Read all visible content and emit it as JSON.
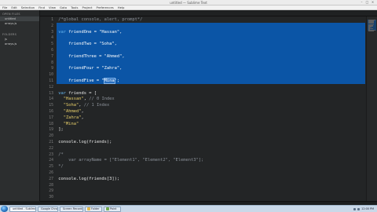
{
  "window": {
    "title": "untitled — Sublime Text"
  },
  "menu": [
    "File",
    "Edit",
    "Selection",
    "Find",
    "View",
    "Goto",
    "Tools",
    "Project",
    "Preferences",
    "Help"
  ],
  "sidebar": {
    "sections": [
      {
        "header": "OPEN FILES",
        "items": [
          "untitled",
          "arrays.js"
        ]
      },
      {
        "header": "FOLDERS",
        "items": [
          "js",
          "arrays.js"
        ]
      }
    ]
  },
  "editor": {
    "lines": [
      {
        "n": "1",
        "text": "/*global console, alert, prompt*/"
      },
      {
        "n": "2",
        "text": ""
      },
      {
        "n": "3",
        "text": "var friendOne = \"Hassan\","
      },
      {
        "n": "4",
        "text": ""
      },
      {
        "n": "5",
        "text": "    friendTwo = \"Soha\","
      },
      {
        "n": "6",
        "text": ""
      },
      {
        "n": "7",
        "text": "    friendThree = \"Ahmed\","
      },
      {
        "n": "8",
        "text": ""
      },
      {
        "n": "9",
        "text": "    friendFour = \"Zahra\","
      },
      {
        "n": "10",
        "text": ""
      },
      {
        "n": "11",
        "text": "    friendFive = \"Mina\";"
      },
      {
        "n": "12",
        "text": ""
      },
      {
        "n": "13",
        "text": "var friends = ["
      },
      {
        "n": "14",
        "text": "  \"Hassan\", // 0 Index"
      },
      {
        "n": "15",
        "text": "  \"Soha\", // 1 Index"
      },
      {
        "n": "16",
        "text": "  \"Ahmed\","
      },
      {
        "n": "17",
        "text": "  \"Zahra\","
      },
      {
        "n": "18",
        "text": "  \"Mina\""
      },
      {
        "n": "19",
        "text": "];"
      },
      {
        "n": "20",
        "text": ""
      },
      {
        "n": "21",
        "text": "console.log(friends);"
      },
      {
        "n": "22",
        "text": ""
      },
      {
        "n": "23",
        "text": "/*"
      },
      {
        "n": "24",
        "text": "    var arrayName = [\"Element1\", \"Element2\", \"Element3\"];"
      },
      {
        "n": "25",
        "text": "*/"
      },
      {
        "n": "26",
        "text": ""
      },
      {
        "n": "27",
        "text": "console.log(friends[3]);"
      },
      {
        "n": "28",
        "text": ""
      },
      {
        "n": "29",
        "text": ""
      },
      {
        "n": "30",
        "text": ""
      }
    ]
  },
  "taskbar": {
    "items": [
      {
        "label": "untitled - Sublime",
        "color": "#ff8c00"
      },
      {
        "label": "Google Chrome",
        "color": "#e0463b"
      },
      {
        "label": "Screen Recorder",
        "color": "#3a9bd8"
      },
      {
        "label": "Folder",
        "color": "#e2b84a"
      },
      {
        "label": "Paint",
        "color": "#6fa84b"
      }
    ],
    "clock": "12:00 PM"
  }
}
